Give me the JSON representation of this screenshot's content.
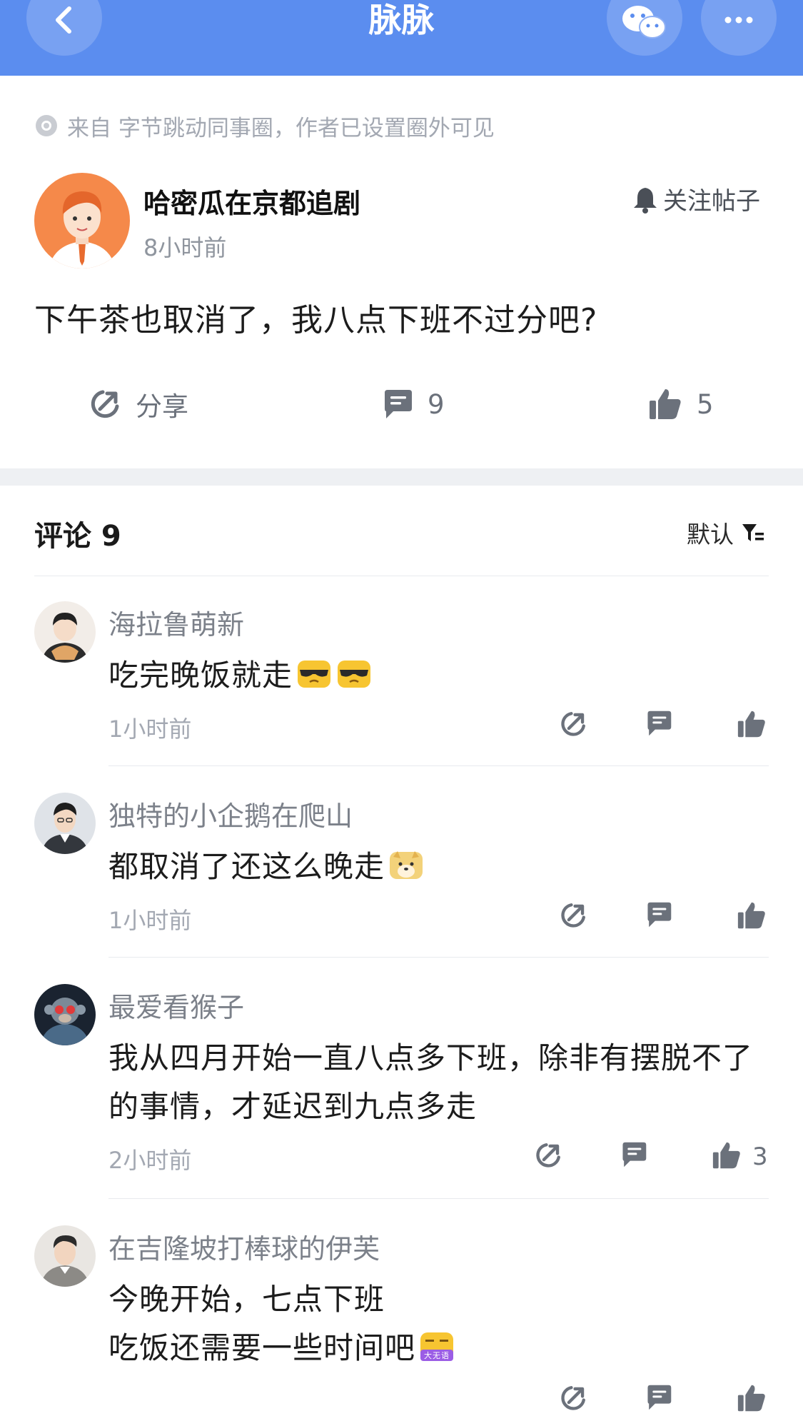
{
  "header": {
    "title": "脉脉"
  },
  "post": {
    "source": "来自 字节跳动同事圈，作者已设置圈外可见",
    "author": "哈密瓜在京都追剧",
    "time": "8小时前",
    "follow_label": "关注帖子",
    "text": "下午茶也取消了，我八点下班不过分吧?",
    "share_label": "分享",
    "comment_count": "9",
    "like_count": "5"
  },
  "comments_header": {
    "title": "评论 9",
    "sort_label": "默认"
  },
  "comments": [
    {
      "name": "海拉鲁萌新",
      "text": "吃完晚饭就走",
      "time": "1小时前",
      "likes": "",
      "emojis": [
        "cool-face-emoji",
        "cool-face-emoji"
      ]
    },
    {
      "name": "独特的小企鹅在爬山",
      "text": "都取消了还这么晚走",
      "time": "1小时前",
      "likes": "",
      "emojis": [
        "doge-emoji"
      ]
    },
    {
      "name": "最爱看猴子",
      "text": "我从四月开始一直八点多下班，除非有摆脱不了的事情，才延迟到九点多走",
      "time": "2小时前",
      "likes": "3",
      "emojis": []
    },
    {
      "name": "在吉隆坡打棒球的伊芙",
      "text_line1": "今晚开始，七点下班",
      "text_line2": "吃饭还需要一些时间吧",
      "time": "",
      "likes": "",
      "emojis": [
        "speechless-emoji"
      ],
      "emoji_caption": "大无语"
    }
  ],
  "colors": {
    "header_bg": "#5b8def",
    "accent_text": "#1a1a1a",
    "muted_text": "#a3a8b2"
  }
}
